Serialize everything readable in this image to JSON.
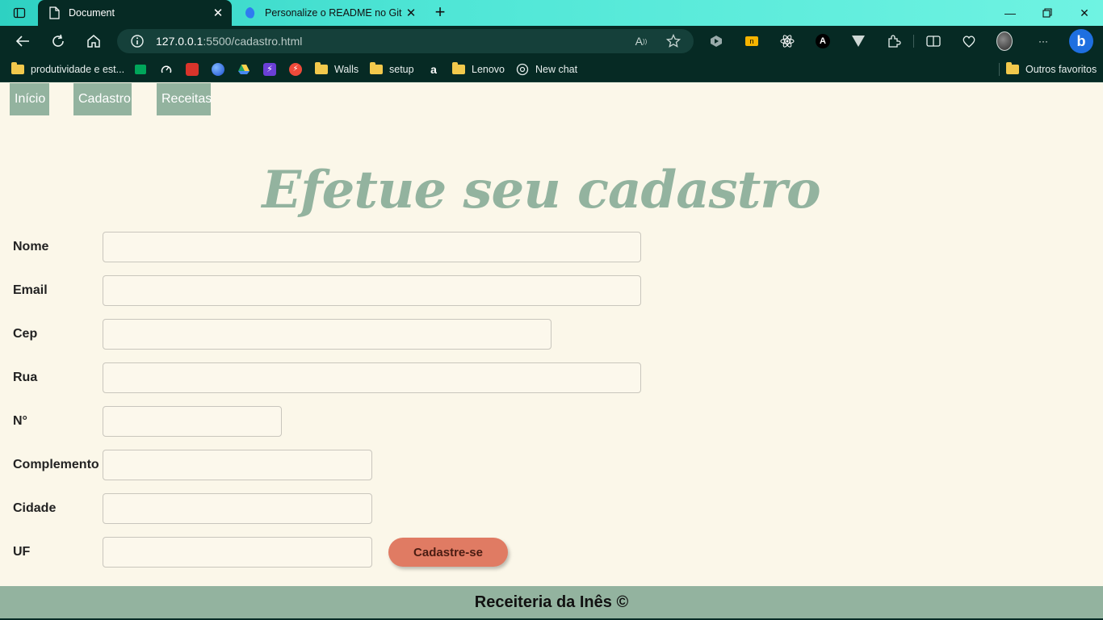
{
  "browser": {
    "tabs": [
      {
        "title": "Document",
        "active": true
      },
      {
        "title": "Personalize o README no GitHub",
        "active": false
      }
    ],
    "address": {
      "host": "127.0.0.1",
      "rest": ":5500/cadastro.html"
    },
    "bookmarks": [
      {
        "label": "produtividade e est...",
        "icon": "folder-icon"
      },
      {
        "label": "",
        "icon": "meet-icon"
      },
      {
        "label": "",
        "icon": "speed-icon"
      },
      {
        "label": "",
        "icon": "red-app-icon"
      },
      {
        "label": "",
        "icon": "globe-icon"
      },
      {
        "label": "",
        "icon": "drive-icon"
      },
      {
        "label": "",
        "icon": "bolt-icon"
      },
      {
        "label": "",
        "icon": "red-bolt-icon"
      },
      {
        "label": "Walls",
        "icon": "folder-icon"
      },
      {
        "label": "setup",
        "icon": "folder-icon"
      },
      {
        "label": "",
        "icon": "amazon-icon"
      },
      {
        "label": "Lenovo",
        "icon": "folder-icon"
      },
      {
        "label": "New chat",
        "icon": "chatgpt-icon"
      }
    ],
    "other_favorites": "Outros favoritos"
  },
  "nav": {
    "inicio": "Início",
    "cadastro": "Cadastro",
    "receitas": "Receitas"
  },
  "heading": "Efetue seu cadastro",
  "form": {
    "nome": "Nome",
    "email": "Email",
    "cep": "Cep",
    "rua": "Rua",
    "numero": "N°",
    "complemento": "Complemento",
    "cidade": "Cidade",
    "uf": "UF",
    "submit": "Cadastre-se"
  },
  "footer": "Receiteria da Inês ©",
  "colors": {
    "accent": "#93b39f",
    "button": "#e07b63",
    "background": "#fbf7e9",
    "chrome": "#062a24"
  }
}
